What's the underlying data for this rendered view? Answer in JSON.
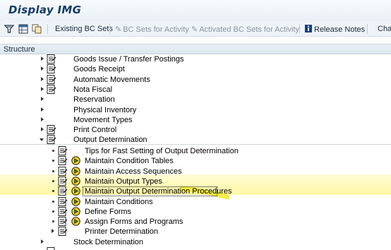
{
  "window": {
    "title": "Display IMG"
  },
  "toolbar": {
    "existing_bc_sets": "Existing BC Sets",
    "bc_sets_for_activity": "BC Sets for Activity",
    "activated_bc_sets": "Activated BC Sets for Activity",
    "release_notes": "Release Notes",
    "change_truncated": "Char"
  },
  "structure": {
    "header": "Structure"
  },
  "tree": {
    "items": [
      {
        "label": "Goods Issue / Transfer Postings"
      },
      {
        "label": "Goods Receipt"
      },
      {
        "label": "Automatic Movements"
      },
      {
        "label": "Nota Fiscal"
      },
      {
        "label": "Reservation"
      },
      {
        "label": "Physical Inventory"
      },
      {
        "label": "Movement Types"
      },
      {
        "label": "Print Control"
      },
      {
        "label": "Output Determination"
      }
    ],
    "children": [
      {
        "label": "Tips for Fast Setting of Output Determination"
      },
      {
        "label": "Maintain Condition Tables"
      },
      {
        "label": "Maintain Access Sequences"
      },
      {
        "label": "Maintain Output Types"
      },
      {
        "label": "Maintain Output Determination Procedures"
      },
      {
        "label": "Maintain Conditions"
      },
      {
        "label": "Define Forms"
      },
      {
        "label": "Assign Forms and Programs"
      },
      {
        "label": "Printer Determination"
      }
    ],
    "after": [
      {
        "label": "Stock Determination"
      }
    ]
  },
  "colors": {
    "title": "#163c63",
    "highlight": "#fff79a",
    "exec_icon": "#f0c020"
  }
}
